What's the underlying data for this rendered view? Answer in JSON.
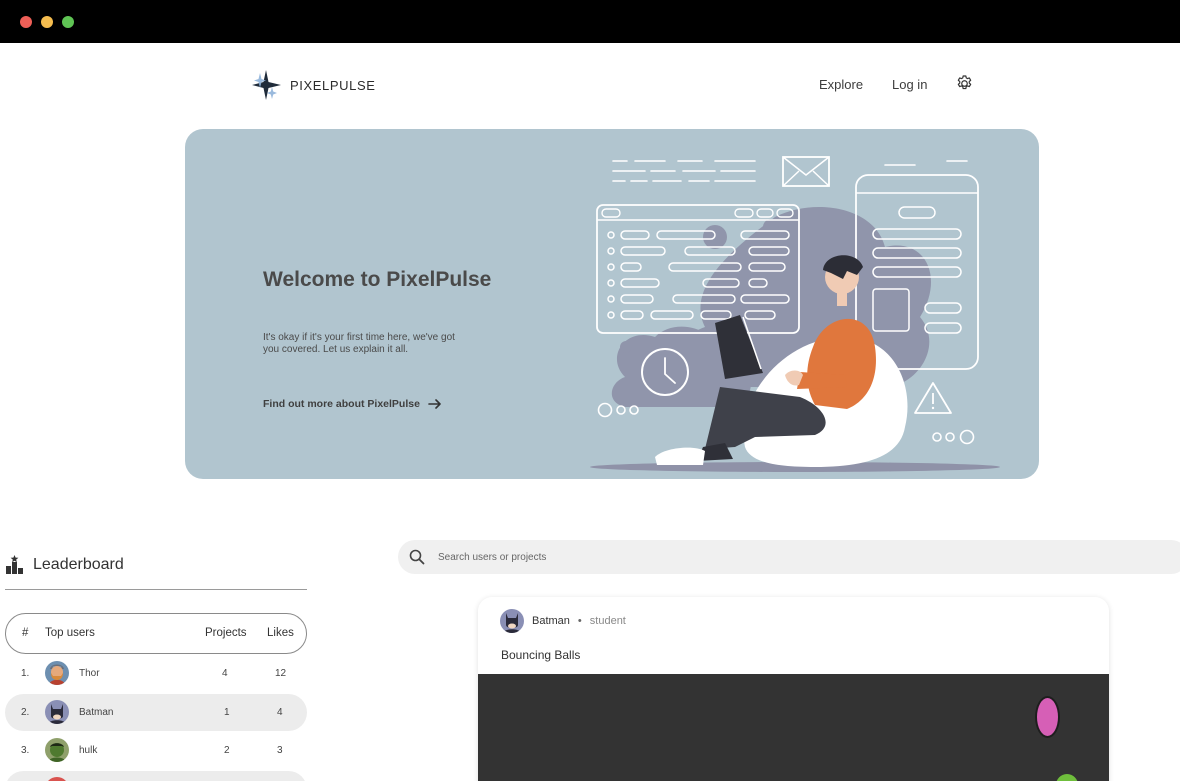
{
  "brand": {
    "name": "PIXELPULSE"
  },
  "nav": {
    "explore": "Explore",
    "login": "Log in",
    "settings_icon": "gear-icon"
  },
  "hero": {
    "title": "Welcome to PixelPulse",
    "description": "It's okay if it's your first time here, we've got you covered. Let us explain it all.",
    "link": "Find out more about PixelPulse",
    "link_icon": "arrow-right-icon"
  },
  "leaderboard": {
    "title": "Leaderboard",
    "icon": "podium-icon",
    "columns": {
      "rank": "#",
      "user": "Top users",
      "projects": "Projects",
      "likes": "Likes"
    },
    "rows": [
      {
        "rank": "1.",
        "name": "Thor",
        "projects": "4",
        "likes": "12"
      },
      {
        "rank": "2.",
        "name": "Batman",
        "projects": "1",
        "likes": "4"
      },
      {
        "rank": "3.",
        "name": "hulk",
        "projects": "2",
        "likes": "3"
      }
    ]
  },
  "search": {
    "placeholder": "Search users or projects",
    "value": ""
  },
  "project": {
    "author": "Batman",
    "separator": "•",
    "role": "student",
    "title": "Bouncing Balls"
  },
  "colors": {
    "hero_bg": "#b1c5cf",
    "accent_orange": "#e0773d",
    "ball_pink": "#d65fb6",
    "ball_green": "#6fbe3c",
    "canvas_bg": "#333333"
  }
}
